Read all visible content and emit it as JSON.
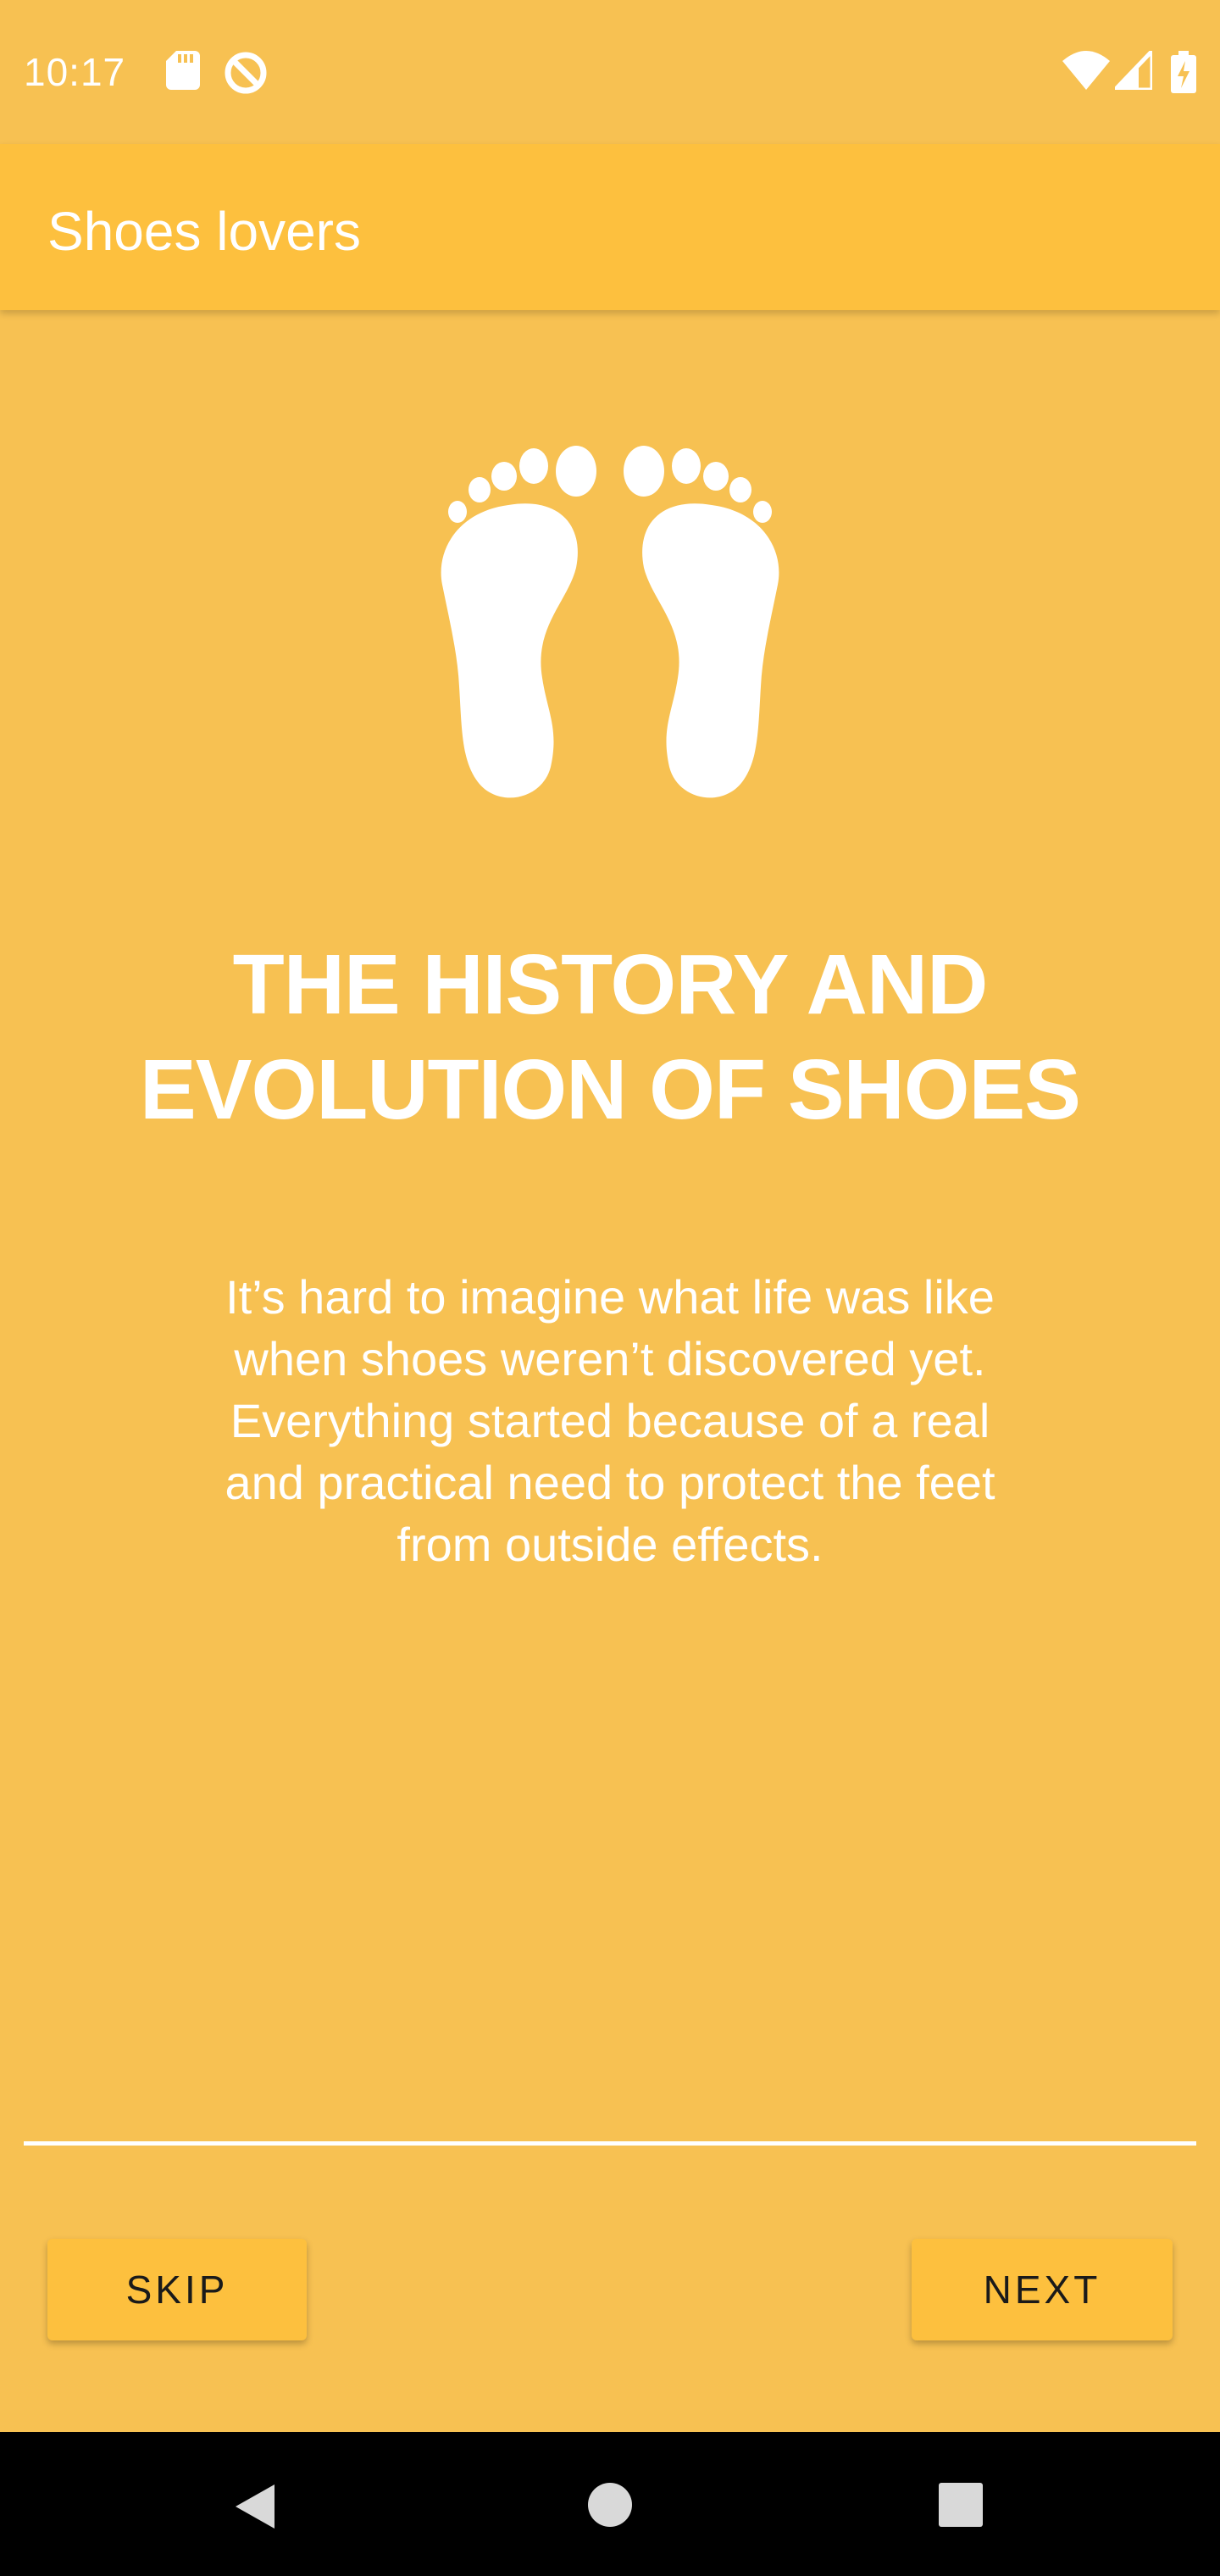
{
  "status_bar": {
    "time": "10:17",
    "icons": [
      "sd-card-icon",
      "data-saver-icon",
      "wifi-icon",
      "signal-icon",
      "battery-charging-icon"
    ]
  },
  "app_bar": {
    "title": "Shoes lovers"
  },
  "onboarding": {
    "illustration": "footprints-icon",
    "title": "THE HISTORY AND EVOLUTION OF SHOES",
    "body": "It’s hard to imagine what life was like when shoes weren’t discovered yet. Everything started because of a real and practical need to protect the feet from outside effects."
  },
  "footer": {
    "skip_label": "SKIP",
    "next_label": "NEXT"
  },
  "nav_bar": {
    "icons": [
      "back-icon",
      "home-icon",
      "recents-icon"
    ]
  },
  "colors": {
    "background": "#F7C152",
    "app_bar": "#FDC03E",
    "button": "#FDC03E",
    "text": "#FFFFFF"
  }
}
